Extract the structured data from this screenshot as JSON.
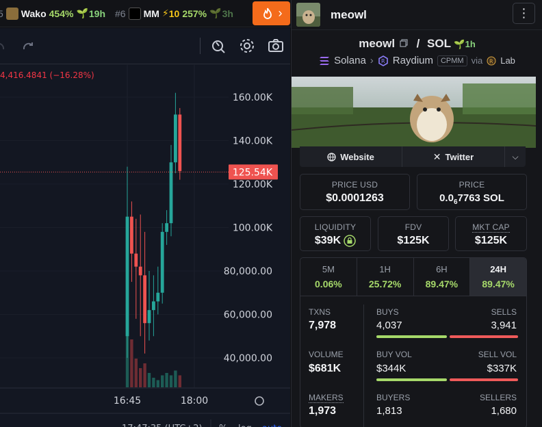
{
  "ticker": {
    "items": [
      {
        "rank": "5",
        "symbol": "Wako",
        "pct": "454%",
        "age": "19h"
      },
      {
        "rank": "#6",
        "symbol": "MM",
        "boost": "10",
        "pct": "257%",
        "age": "3h"
      }
    ],
    "fire_icon": "fire-icon"
  },
  "chart": {
    "change_text": "4,416.4841 (−16.28%)",
    "current_price_label": "125.54K",
    "y_ticks": [
      "160.00K",
      "140.00K",
      "120.00K",
      "100.00K",
      "80,000.00",
      "60,000.00",
      "40,000.00"
    ],
    "x_ticks": [
      "16:45",
      "18:00"
    ],
    "footer_time": "17:47:35 (UTC+2)",
    "footer_pct": "%",
    "footer_log": "log",
    "footer_auto": "auto",
    "colors": {
      "up": "#26a69a",
      "down": "#ef5350",
      "bg": "#131722"
    }
  },
  "chart_data": {
    "type": "candlestick",
    "ylim": [
      30000,
      170000
    ],
    "y_unit": "USD market cap",
    "candles": [
      {
        "o": 50000,
        "h": 128000,
        "l": 40000,
        "c": 105000
      },
      {
        "o": 105000,
        "h": 112000,
        "l": 75000,
        "c": 88000
      },
      {
        "o": 88000,
        "h": 104000,
        "l": 58000,
        "c": 82000
      },
      {
        "o": 82000,
        "h": 106000,
        "l": 50000,
        "c": 78000
      },
      {
        "o": 78000,
        "h": 98000,
        "l": 42000,
        "c": 56000
      },
      {
        "o": 56000,
        "h": 80000,
        "l": 48000,
        "c": 62000
      },
      {
        "o": 62000,
        "h": 78000,
        "l": 50000,
        "c": 66000
      },
      {
        "o": 66000,
        "h": 82000,
        "l": 60000,
        "c": 70000
      },
      {
        "o": 70000,
        "h": 102000,
        "l": 65000,
        "c": 98000
      },
      {
        "o": 98000,
        "h": 108000,
        "l": 92000,
        "c": 102000
      },
      {
        "o": 102000,
        "h": 138000,
        "l": 96000,
        "c": 130000
      },
      {
        "o": 130000,
        "h": 162000,
        "l": 125000,
        "c": 152000
      },
      {
        "o": 152000,
        "h": 155000,
        "l": 122000,
        "c": 126000
      }
    ],
    "volumes": [
      0.35,
      0.2,
      0.12,
      0.08,
      0.1,
      0.06,
      0.04,
      0.03,
      0.05,
      0.06,
      0.05,
      0.07,
      0.05
    ],
    "price_line": 125540
  },
  "panel": {
    "title": "meowl",
    "menu_icon": "more-vertical-icon",
    "pair_base": "meowl",
    "pair_sep": "/",
    "pair_quote": "SOL",
    "pair_age": "1h",
    "chain": "Solana",
    "dex": "Raydium",
    "dex_type": "CPMM",
    "via": "via",
    "launchpad": "Lab",
    "links": {
      "website": "Website",
      "twitter": "Twitter"
    },
    "price_usd_label": "PRICE USD",
    "price_usd": "$0.0001263",
    "price_label": "PRICE",
    "price_prefix": "0.0",
    "price_sub": "6",
    "price_rest": "7763 SOL",
    "liquidity_label": "LIQUIDITY",
    "liquidity": "$39K",
    "fdv_label": "FDV",
    "fdv": "$125K",
    "mcap_label": "MKT CAP",
    "mcap": "$125K",
    "timeframes": [
      {
        "name": "5M",
        "pct": "0.06%"
      },
      {
        "name": "1H",
        "pct": "25.72%"
      },
      {
        "name": "6H",
        "pct": "89.47%"
      },
      {
        "name": "24H",
        "pct": "89.47%"
      }
    ],
    "stats": {
      "txns_label": "TXNS",
      "txns": "7,978",
      "buys_label": "BUYS",
      "buys": "4,037",
      "sells_label": "SELLS",
      "sells": "3,941",
      "volume_label": "VOLUME",
      "volume": "$681K",
      "buyvol_label": "BUY VOL",
      "buyvol": "$344K",
      "sellvol_label": "SELL VOL",
      "sellvol": "$337K",
      "makers_label": "MAKERS",
      "makers": "1,973",
      "buyers_label": "BUYERS",
      "buyers": "1,813",
      "sellers_label": "SELLERS",
      "sellers": "1,680"
    },
    "ratios": {
      "buys": 0.506,
      "buyvol": 0.505,
      "buyers": 0.519
    },
    "colors": {
      "green": "#a6d96a",
      "red": "#ef5a5a"
    }
  }
}
